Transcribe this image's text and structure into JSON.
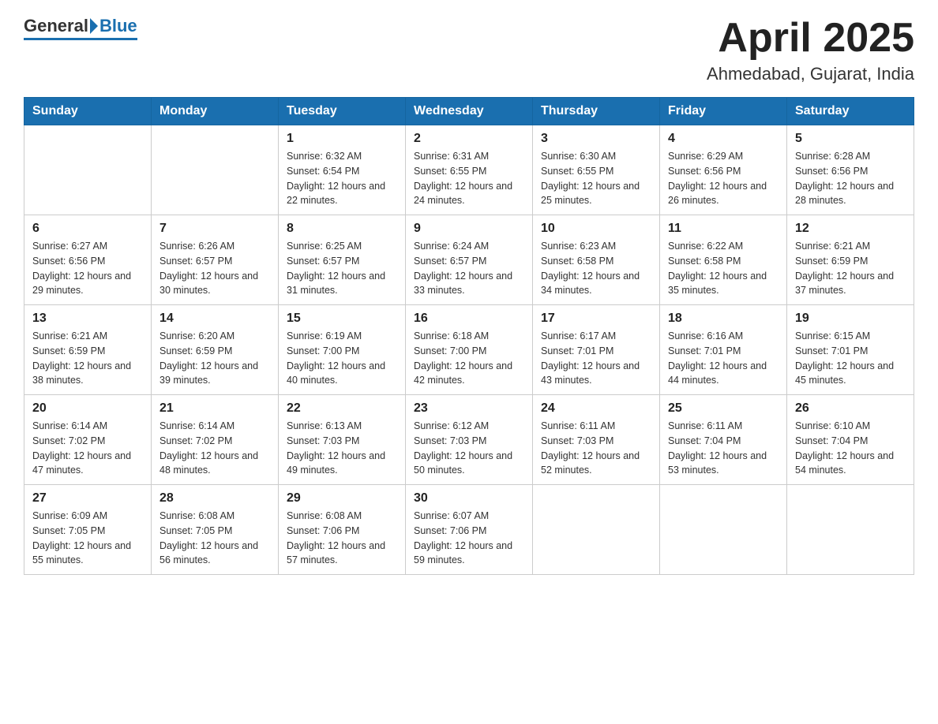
{
  "header": {
    "logo": {
      "general": "General",
      "blue": "Blue"
    },
    "title": "April 2025",
    "subtitle": "Ahmedabad, Gujarat, India"
  },
  "calendar": {
    "days_of_week": [
      "Sunday",
      "Monday",
      "Tuesday",
      "Wednesday",
      "Thursday",
      "Friday",
      "Saturday"
    ],
    "weeks": [
      [
        {
          "day": "",
          "sunrise": "",
          "sunset": "",
          "daylight": ""
        },
        {
          "day": "",
          "sunrise": "",
          "sunset": "",
          "daylight": ""
        },
        {
          "day": "1",
          "sunrise": "Sunrise: 6:32 AM",
          "sunset": "Sunset: 6:54 PM",
          "daylight": "Daylight: 12 hours and 22 minutes."
        },
        {
          "day": "2",
          "sunrise": "Sunrise: 6:31 AM",
          "sunset": "Sunset: 6:55 PM",
          "daylight": "Daylight: 12 hours and 24 minutes."
        },
        {
          "day": "3",
          "sunrise": "Sunrise: 6:30 AM",
          "sunset": "Sunset: 6:55 PM",
          "daylight": "Daylight: 12 hours and 25 minutes."
        },
        {
          "day": "4",
          "sunrise": "Sunrise: 6:29 AM",
          "sunset": "Sunset: 6:56 PM",
          "daylight": "Daylight: 12 hours and 26 minutes."
        },
        {
          "day": "5",
          "sunrise": "Sunrise: 6:28 AM",
          "sunset": "Sunset: 6:56 PM",
          "daylight": "Daylight: 12 hours and 28 minutes."
        }
      ],
      [
        {
          "day": "6",
          "sunrise": "Sunrise: 6:27 AM",
          "sunset": "Sunset: 6:56 PM",
          "daylight": "Daylight: 12 hours and 29 minutes."
        },
        {
          "day": "7",
          "sunrise": "Sunrise: 6:26 AM",
          "sunset": "Sunset: 6:57 PM",
          "daylight": "Daylight: 12 hours and 30 minutes."
        },
        {
          "day": "8",
          "sunrise": "Sunrise: 6:25 AM",
          "sunset": "Sunset: 6:57 PM",
          "daylight": "Daylight: 12 hours and 31 minutes."
        },
        {
          "day": "9",
          "sunrise": "Sunrise: 6:24 AM",
          "sunset": "Sunset: 6:57 PM",
          "daylight": "Daylight: 12 hours and 33 minutes."
        },
        {
          "day": "10",
          "sunrise": "Sunrise: 6:23 AM",
          "sunset": "Sunset: 6:58 PM",
          "daylight": "Daylight: 12 hours and 34 minutes."
        },
        {
          "day": "11",
          "sunrise": "Sunrise: 6:22 AM",
          "sunset": "Sunset: 6:58 PM",
          "daylight": "Daylight: 12 hours and 35 minutes."
        },
        {
          "day": "12",
          "sunrise": "Sunrise: 6:21 AM",
          "sunset": "Sunset: 6:59 PM",
          "daylight": "Daylight: 12 hours and 37 minutes."
        }
      ],
      [
        {
          "day": "13",
          "sunrise": "Sunrise: 6:21 AM",
          "sunset": "Sunset: 6:59 PM",
          "daylight": "Daylight: 12 hours and 38 minutes."
        },
        {
          "day": "14",
          "sunrise": "Sunrise: 6:20 AM",
          "sunset": "Sunset: 6:59 PM",
          "daylight": "Daylight: 12 hours and 39 minutes."
        },
        {
          "day": "15",
          "sunrise": "Sunrise: 6:19 AM",
          "sunset": "Sunset: 7:00 PM",
          "daylight": "Daylight: 12 hours and 40 minutes."
        },
        {
          "day": "16",
          "sunrise": "Sunrise: 6:18 AM",
          "sunset": "Sunset: 7:00 PM",
          "daylight": "Daylight: 12 hours and 42 minutes."
        },
        {
          "day": "17",
          "sunrise": "Sunrise: 6:17 AM",
          "sunset": "Sunset: 7:01 PM",
          "daylight": "Daylight: 12 hours and 43 minutes."
        },
        {
          "day": "18",
          "sunrise": "Sunrise: 6:16 AM",
          "sunset": "Sunset: 7:01 PM",
          "daylight": "Daylight: 12 hours and 44 minutes."
        },
        {
          "day": "19",
          "sunrise": "Sunrise: 6:15 AM",
          "sunset": "Sunset: 7:01 PM",
          "daylight": "Daylight: 12 hours and 45 minutes."
        }
      ],
      [
        {
          "day": "20",
          "sunrise": "Sunrise: 6:14 AM",
          "sunset": "Sunset: 7:02 PM",
          "daylight": "Daylight: 12 hours and 47 minutes."
        },
        {
          "day": "21",
          "sunrise": "Sunrise: 6:14 AM",
          "sunset": "Sunset: 7:02 PM",
          "daylight": "Daylight: 12 hours and 48 minutes."
        },
        {
          "day": "22",
          "sunrise": "Sunrise: 6:13 AM",
          "sunset": "Sunset: 7:03 PM",
          "daylight": "Daylight: 12 hours and 49 minutes."
        },
        {
          "day": "23",
          "sunrise": "Sunrise: 6:12 AM",
          "sunset": "Sunset: 7:03 PM",
          "daylight": "Daylight: 12 hours and 50 minutes."
        },
        {
          "day": "24",
          "sunrise": "Sunrise: 6:11 AM",
          "sunset": "Sunset: 7:03 PM",
          "daylight": "Daylight: 12 hours and 52 minutes."
        },
        {
          "day": "25",
          "sunrise": "Sunrise: 6:11 AM",
          "sunset": "Sunset: 7:04 PM",
          "daylight": "Daylight: 12 hours and 53 minutes."
        },
        {
          "day": "26",
          "sunrise": "Sunrise: 6:10 AM",
          "sunset": "Sunset: 7:04 PM",
          "daylight": "Daylight: 12 hours and 54 minutes."
        }
      ],
      [
        {
          "day": "27",
          "sunrise": "Sunrise: 6:09 AM",
          "sunset": "Sunset: 7:05 PM",
          "daylight": "Daylight: 12 hours and 55 minutes."
        },
        {
          "day": "28",
          "sunrise": "Sunrise: 6:08 AM",
          "sunset": "Sunset: 7:05 PM",
          "daylight": "Daylight: 12 hours and 56 minutes."
        },
        {
          "day": "29",
          "sunrise": "Sunrise: 6:08 AM",
          "sunset": "Sunset: 7:06 PM",
          "daylight": "Daylight: 12 hours and 57 minutes."
        },
        {
          "day": "30",
          "sunrise": "Sunrise: 6:07 AM",
          "sunset": "Sunset: 7:06 PM",
          "daylight": "Daylight: 12 hours and 59 minutes."
        },
        {
          "day": "",
          "sunrise": "",
          "sunset": "",
          "daylight": ""
        },
        {
          "day": "",
          "sunrise": "",
          "sunset": "",
          "daylight": ""
        },
        {
          "day": "",
          "sunrise": "",
          "sunset": "",
          "daylight": ""
        }
      ]
    ]
  }
}
